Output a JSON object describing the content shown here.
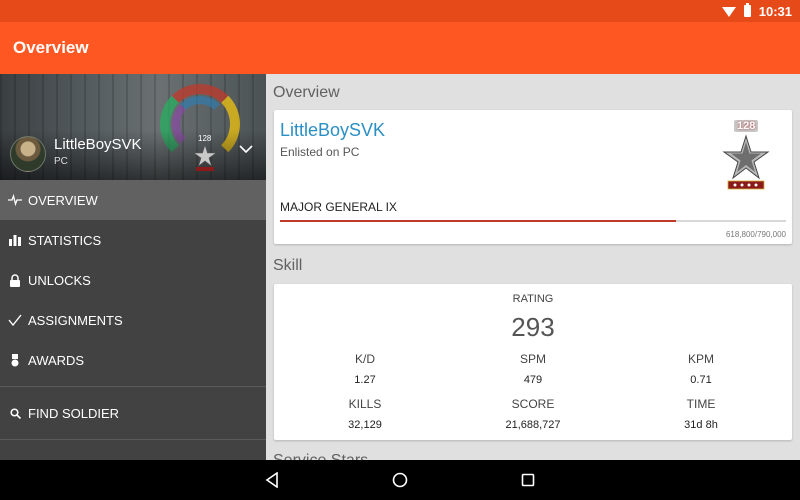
{
  "status_bar": {
    "time": "10:31",
    "icons": [
      "wifi-icon",
      "battery-icon"
    ]
  },
  "app_bar": {
    "title": "Overview"
  },
  "drawer": {
    "profile": {
      "name": "LittleBoySVK",
      "platform": "PC",
      "rank_number": "128"
    },
    "items": [
      {
        "label": "OVERVIEW",
        "icon": "pulse-icon",
        "active": true
      },
      {
        "label": "STATISTICS",
        "icon": "bar-chart-icon",
        "active": false
      },
      {
        "label": "UNLOCKS",
        "icon": "lock-icon",
        "active": false
      },
      {
        "label": "ASSIGNMENTS",
        "icon": "check-icon",
        "active": false
      },
      {
        "label": "AWARDS",
        "icon": "medal-icon",
        "active": false
      }
    ],
    "find_soldier": {
      "label": "FIND SOLDIER",
      "icon": "search-icon"
    }
  },
  "overview": {
    "section_title": "Overview",
    "name": "LittleBoySVK",
    "enlisted_prefix": "Enlisted on",
    "platform": "PC",
    "rank_number": "128",
    "rank_title": "MAJOR GENERAL IX",
    "xp_text": "618,800/790,000",
    "progress_fraction": 0.783
  },
  "skill": {
    "section_title": "Skill",
    "rating_label": "RATING",
    "rating_value": "293",
    "stats": [
      {
        "label": "K/D",
        "value": "1.27"
      },
      {
        "label": "SPM",
        "value": "479"
      },
      {
        "label": "KPM",
        "value": "0.71"
      },
      {
        "label": "KILLS",
        "value": "32,129"
      },
      {
        "label": "SCORE",
        "value": "21,688,727"
      },
      {
        "label": "TIME",
        "value": "31d 8h"
      }
    ]
  },
  "service_stars": {
    "section_title": "Service Stars"
  },
  "colors": {
    "status_bar": "#e64a19",
    "app_bar": "#ff5722",
    "drawer": "#424242",
    "accent_name": "#2a8fc4",
    "progress": "#c0392b"
  }
}
